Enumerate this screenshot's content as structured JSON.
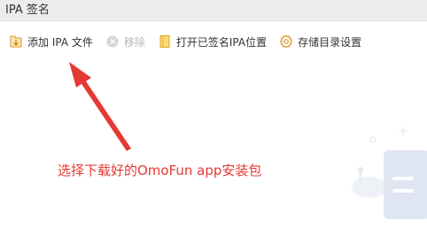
{
  "window": {
    "title": "IPA 签名"
  },
  "toolbar": {
    "add_ipa": {
      "label": "添加 IPA 文件",
      "icon": "add-file-icon"
    },
    "remove": {
      "label": "移除",
      "icon": "remove-icon",
      "disabled": true
    },
    "open_folder": {
      "label": "打开已签名IPA位置",
      "icon": "folder-icon"
    },
    "storage_settings": {
      "label": "存储目录设置",
      "icon": "gear-icon"
    }
  },
  "annotation": {
    "text": "选择下载好的OmoFun app安装包",
    "color": "#e53935"
  },
  "colors": {
    "accent": "#e8a93a",
    "annotation": "#e53935",
    "illustration": "#dfe6f1"
  }
}
